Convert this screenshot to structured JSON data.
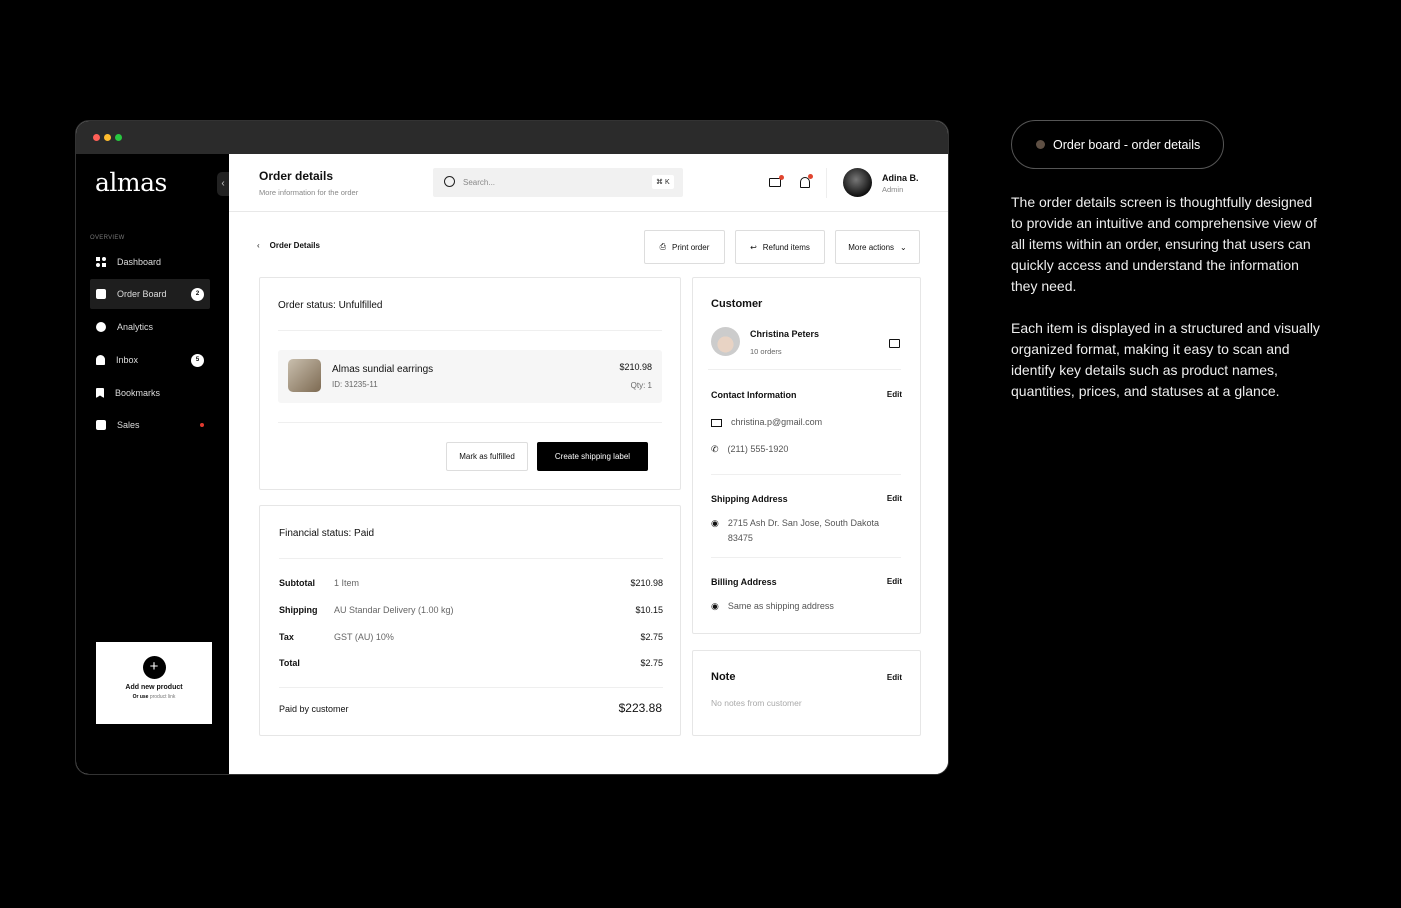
{
  "window": {
    "controls": {
      "close": "#ff5f57",
      "minimize": "#febc2e",
      "maximize": "#28c840"
    }
  },
  "sidebar": {
    "logo": "almas",
    "section": "OVERVIEW",
    "items": [
      {
        "label": "Dashboard",
        "icon": "grid-icon"
      },
      {
        "label": "Order Board",
        "icon": "order-icon",
        "badge": "2",
        "active": true
      },
      {
        "label": "Analytics",
        "icon": "pie-chart-icon"
      },
      {
        "label": "Inbox",
        "icon": "bell-icon",
        "badge": "5"
      },
      {
        "label": "Bookmarks",
        "icon": "bookmark-icon"
      },
      {
        "label": "Sales",
        "icon": "bag-icon",
        "status_dot": "#e03a2f"
      }
    ],
    "add_product": {
      "title": "Add new product",
      "hint_prefix": "Or use",
      "hint_link": "product link"
    }
  },
  "header": {
    "title": "Order details",
    "subtitle": "More information for the order",
    "search_placeholder": "Search...",
    "shortcut": "⌘ K",
    "user": {
      "name": "Adina B.",
      "role": "Admin"
    }
  },
  "breadcrumb": "Order Details",
  "actions": {
    "print": "Print order",
    "refund": "Refund items",
    "more": "More actions"
  },
  "order": {
    "status": "Order status: Unfulfilled",
    "item": {
      "name": "Almas sundial earrings",
      "id": "ID: 31235-11",
      "price": "$210.98",
      "qty": "Qty: 1"
    },
    "mark_fulfilled": "Mark as fulfilled",
    "create_label": "Create shipping label"
  },
  "financial": {
    "status": "Financial status: Paid",
    "rows": [
      {
        "label": "Subtotal",
        "desc": "1 Item",
        "amount": "$210.98"
      },
      {
        "label": "Shipping",
        "desc": "AU Standar Delivery (1.00 kg)",
        "amount": "$10.15"
      },
      {
        "label": "Tax",
        "desc": "GST (AU) 10%",
        "amount": "$2.75"
      },
      {
        "label": "Total",
        "desc": "",
        "amount": "$2.75"
      }
    ],
    "paid_label": "Paid by customer",
    "paid_amount": "$223.88"
  },
  "customer": {
    "title": "Customer",
    "name": "Christina Peters",
    "orders": "10 orders",
    "contact_title": "Contact Information",
    "email": "christina.p@gmail.com",
    "phone": "(211) 555-1920",
    "shipping_title": "Shipping Address",
    "shipping": "2715 Ash Dr. San Jose, South Dakota 83475",
    "billing_title": "Billing Address",
    "billing": "Same as shipping address",
    "edit": "Edit"
  },
  "note": {
    "title": "Note",
    "edit": "Edit",
    "text": "No notes from customer"
  },
  "caption": {
    "pill": "Order board - order details",
    "p1": "The order details screen is thoughtfully designed to provide an intuitive and comprehensive view of all items within an order, ensuring that users can quickly access and understand the information they need.",
    "p2": "Each item is displayed in a structured and visually organized format, making it easy to scan and identify key details such as product names, quantities, prices, and statuses at a glance."
  }
}
